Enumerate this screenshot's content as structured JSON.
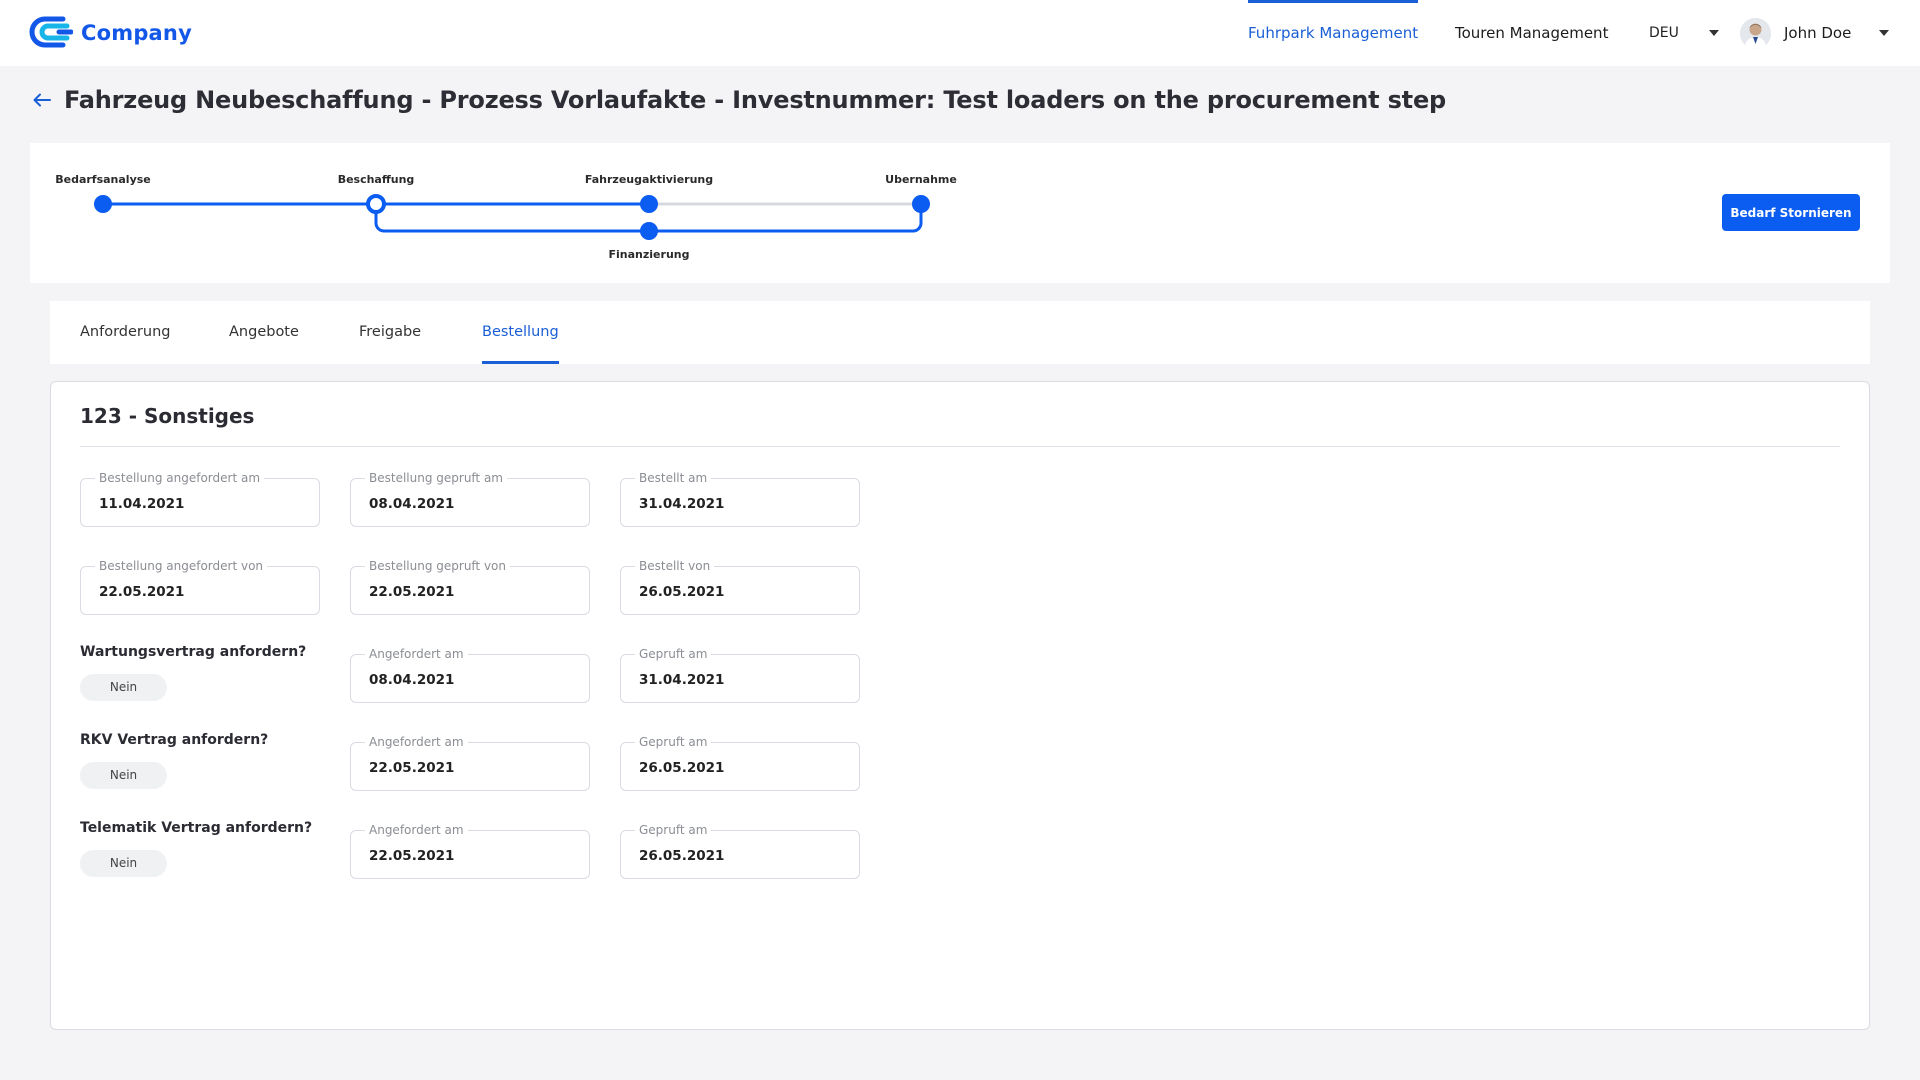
{
  "brand": {
    "name": "Company",
    "accent": "#1257e8"
  },
  "nav": {
    "fuhrpark": "Fuhrpark Management",
    "touren": "Touren Management",
    "language": "DEU"
  },
  "user": {
    "name": "John Doe"
  },
  "page": {
    "title": "Fahrzeug Neubeschaffung - Prozess Vorlaufakte - Investnummer: Test loaders on the procurement step"
  },
  "stepper": {
    "steps": [
      "Bedarfsanalyse",
      "Beschaffung",
      "Fahrzeugaktivierung",
      "Ubernahme"
    ],
    "branch_step": "Finanzierung",
    "active_color": "#0b5cf0",
    "inactive_color": "#d6d8dd"
  },
  "actions": {
    "cancel_label": "Bedarf Stornieren"
  },
  "tabs": [
    "Anforderung",
    "Angebote",
    "Freigabe",
    "Bestellung"
  ],
  "active_tab": "Bestellung",
  "section": {
    "title": "123 - Sonstiges",
    "rows": [
      [
        {
          "label": "Bestellung angefordert am",
          "value": "11.04.2021"
        },
        {
          "label": "Bestellung gepruft am",
          "value": "08.04.2021"
        },
        {
          "label": "Bestellt am",
          "value": "31.04.2021"
        }
      ],
      [
        {
          "label": "Bestellung angefordert von",
          "value": "22.05.2021"
        },
        {
          "label": "Bestellung gepruft von",
          "value": "22.05.2021"
        },
        {
          "label": "Bestellt von",
          "value": "26.05.2021"
        }
      ]
    ],
    "contracts": [
      {
        "question": "Wartungsvertrag anfordern?",
        "answer": "Nein",
        "fields": [
          {
            "label": "Angefordert am",
            "value": "08.04.2021"
          },
          {
            "label": "Gepruft am",
            "value": "31.04.2021"
          }
        ]
      },
      {
        "question": "RKV Vertrag anfordern?",
        "answer": "Nein",
        "fields": [
          {
            "label": "Angefordert am",
            "value": "22.05.2021"
          },
          {
            "label": "Gepruft am",
            "value": "26.05.2021"
          }
        ]
      },
      {
        "question": "Telematik Vertrag anfordern?",
        "answer": "Nein",
        "fields": [
          {
            "label": "Angefordert am",
            "value": "22.05.2021"
          },
          {
            "label": "Gepruft am",
            "value": "26.05.2021"
          }
        ]
      }
    ]
  }
}
